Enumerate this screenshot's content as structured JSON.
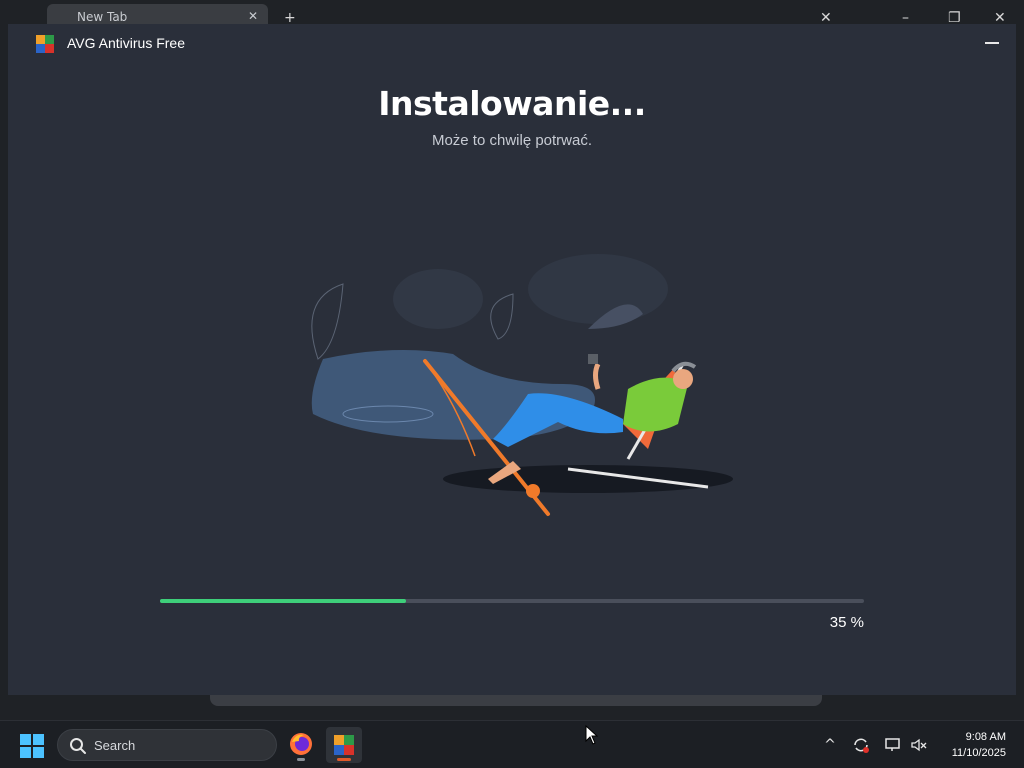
{
  "background_browser": {
    "tab_label": "New Tab",
    "tab_close": "✕",
    "new_tab": "+"
  },
  "installer": {
    "app_title": "AVG Antivirus Free",
    "heading": "Instalowanie...",
    "subheading": "Może to chwilę potrwać.",
    "progress_percent": 35,
    "progress_label": "35 %",
    "colors": {
      "background": "#2a2f3a",
      "progress_fill": "#3ecf7a",
      "progress_track": "#4a4f5b"
    }
  },
  "taskbar": {
    "search_placeholder": "Search",
    "apps": [
      {
        "name": "firefox-icon",
        "active": false
      },
      {
        "name": "avg-installer-icon",
        "active": true
      }
    ],
    "tray": {
      "show_hidden": "^",
      "time": "9:08 AM",
      "date": "11/10/2025"
    }
  }
}
